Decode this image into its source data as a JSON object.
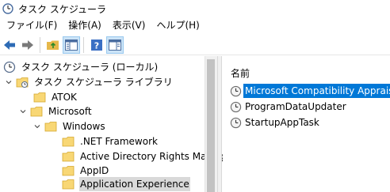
{
  "window": {
    "title": "タスク スケジューラ",
    "icon": "clock-icon"
  },
  "menu": {
    "items": [
      "ファイル(F)",
      "操作(A)",
      "表示(V)",
      "ヘルプ(H)"
    ]
  },
  "toolbar": {
    "buttons": [
      "back-arrow-icon",
      "forward-arrow-icon",
      "folder-up-icon",
      "show-hide-tree-icon",
      "help-icon",
      "action-pane-icon"
    ]
  },
  "tree": {
    "items": [
      {
        "label": "タスク スケジューラ (ローカル)",
        "icon": "clock-icon",
        "expander": "none",
        "selected": false
      },
      {
        "label": "タスク スケジューラ ライブラリ",
        "icon": "library-folder-icon",
        "expander": "expanded",
        "selected": false
      },
      {
        "label": "ATOK",
        "icon": "folder-icon",
        "expander": "none",
        "selected": false
      },
      {
        "label": "Microsoft",
        "icon": "folder-icon",
        "expander": "expanded",
        "selected": false
      },
      {
        "label": "Windows",
        "icon": "folder-icon",
        "expander": "expanded",
        "selected": false
      },
      {
        "label": ".NET Framework",
        "icon": "folder-icon",
        "expander": "none",
        "selected": false
      },
      {
        "label": "Active Directory Rights Manag",
        "icon": "folder-icon",
        "expander": "none",
        "selected": false
      },
      {
        "label": "AppID",
        "icon": "folder-icon",
        "expander": "none",
        "selected": false
      },
      {
        "label": "Application Experience",
        "icon": "folder-icon",
        "expander": "none",
        "selected": true
      }
    ]
  },
  "task_list": {
    "column_header": "名前",
    "tasks": [
      {
        "name": "Microsoft Compatibility Appraiser",
        "selected": true
      },
      {
        "name": "ProgramDataUpdater",
        "selected": false
      },
      {
        "name": "StartupAppTask",
        "selected": false
      }
    ]
  },
  "colors": {
    "selection": "#0078d7",
    "folder": "#f8d775",
    "inactive_selection": "#d9d9d9"
  }
}
